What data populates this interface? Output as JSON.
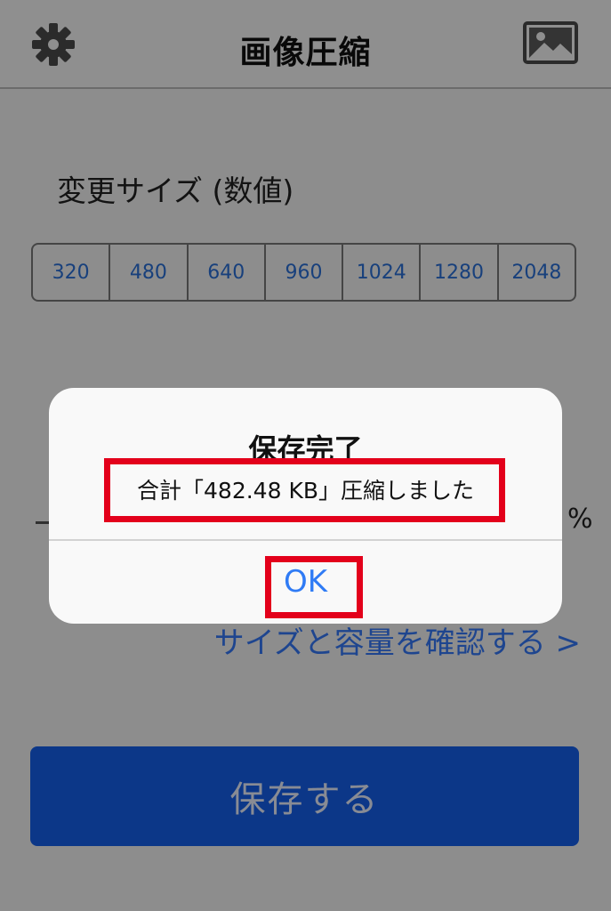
{
  "navbar": {
    "title": "画像圧縮",
    "left_icon": "gear-icon",
    "right_icon": "image-icon"
  },
  "resize": {
    "label": "変更サイズ (数値)",
    "options": [
      "320",
      "480",
      "640",
      "960",
      "1024",
      "1280",
      "2048"
    ]
  },
  "quality": {
    "unit": "%"
  },
  "check_link": "サイズと容量を確認する >",
  "save_button": "保存する",
  "alert": {
    "title": "保存完了",
    "message": "合計「482.48 KB」圧縮しました",
    "ok": "OK"
  },
  "colors": {
    "accent": "#3478f6",
    "save_button": "#1560ea",
    "highlight": "#e3001b"
  }
}
